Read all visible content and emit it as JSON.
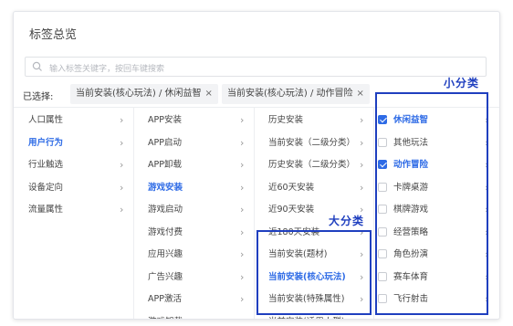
{
  "title": "标签总览",
  "search": {
    "placeholder": "输入标签关键字，按回车键搜索"
  },
  "selected": {
    "label": "已选择:",
    "tags": [
      {
        "text": "当前安装(核心玩法) / 休闲益智",
        "close": "×"
      },
      {
        "text": "当前安装(核心玩法) / 动作冒险",
        "close": "×"
      }
    ]
  },
  "columns": {
    "col1": [
      {
        "label": "人口属性",
        "arrow": "›"
      },
      {
        "label": "用户行为",
        "arrow": "›",
        "active": true
      },
      {
        "label": "行业触选",
        "arrow": "›"
      },
      {
        "label": "设备定向",
        "arrow": "›"
      },
      {
        "label": "流量属性",
        "arrow": "›"
      }
    ],
    "col2": [
      {
        "label": "APP安装",
        "arrow": "›"
      },
      {
        "label": "APP启动",
        "arrow": "›"
      },
      {
        "label": "APP卸载",
        "arrow": "›"
      },
      {
        "label": "游戏安装",
        "arrow": "›",
        "active": true
      },
      {
        "label": "游戏启动",
        "arrow": "›"
      },
      {
        "label": "游戏付费",
        "arrow": "›"
      },
      {
        "label": "应用兴趣",
        "arrow": "›"
      },
      {
        "label": "广告兴趣",
        "arrow": "›"
      },
      {
        "label": "APP激活",
        "arrow": "›"
      },
      {
        "label": "游戏卸载",
        "arrow": "›"
      }
    ],
    "col3": [
      {
        "label": "历史安装",
        "arrow": "›"
      },
      {
        "label": "当前安装（二级分类）",
        "arrow": "›"
      },
      {
        "label": "历史安装（二级分类）",
        "arrow": "›"
      },
      {
        "label": "近60天安装",
        "arrow": "›"
      },
      {
        "label": "近90天安装",
        "arrow": "›"
      },
      {
        "label": "近180天安装",
        "arrow": "›"
      },
      {
        "label": "当前安装(题材)",
        "arrow": "›"
      },
      {
        "label": "当前安装(核心玩法)",
        "arrow": "›",
        "active": true
      },
      {
        "label": "当前安装(特殊属性)",
        "arrow": "›"
      },
      {
        "label": "当前安装(适用人群)",
        "arrow": "›"
      }
    ],
    "col4": [
      {
        "label": "休闲益智",
        "arrow": "›",
        "checked": true,
        "active": true
      },
      {
        "label": "其他玩法",
        "arrow": "›",
        "checked": false
      },
      {
        "label": "动作冒险",
        "arrow": "›",
        "checked": true,
        "active": true
      },
      {
        "label": "卡牌桌游",
        "arrow": "›",
        "checked": false
      },
      {
        "label": "棋牌游戏",
        "arrow": "›",
        "checked": false
      },
      {
        "label": "经营策略",
        "arrow": "›",
        "checked": false
      },
      {
        "label": "角色扮演",
        "arrow": "›",
        "checked": false
      },
      {
        "label": "赛车体育",
        "arrow": "›",
        "checked": false
      },
      {
        "label": "飞行射击",
        "arrow": "›",
        "checked": false
      }
    ]
  },
  "annotations": {
    "big_category": "大分类",
    "small_category": "小分类"
  },
  "colors": {
    "accent": "#2e6be6",
    "annotation": "#1f3fbf"
  }
}
